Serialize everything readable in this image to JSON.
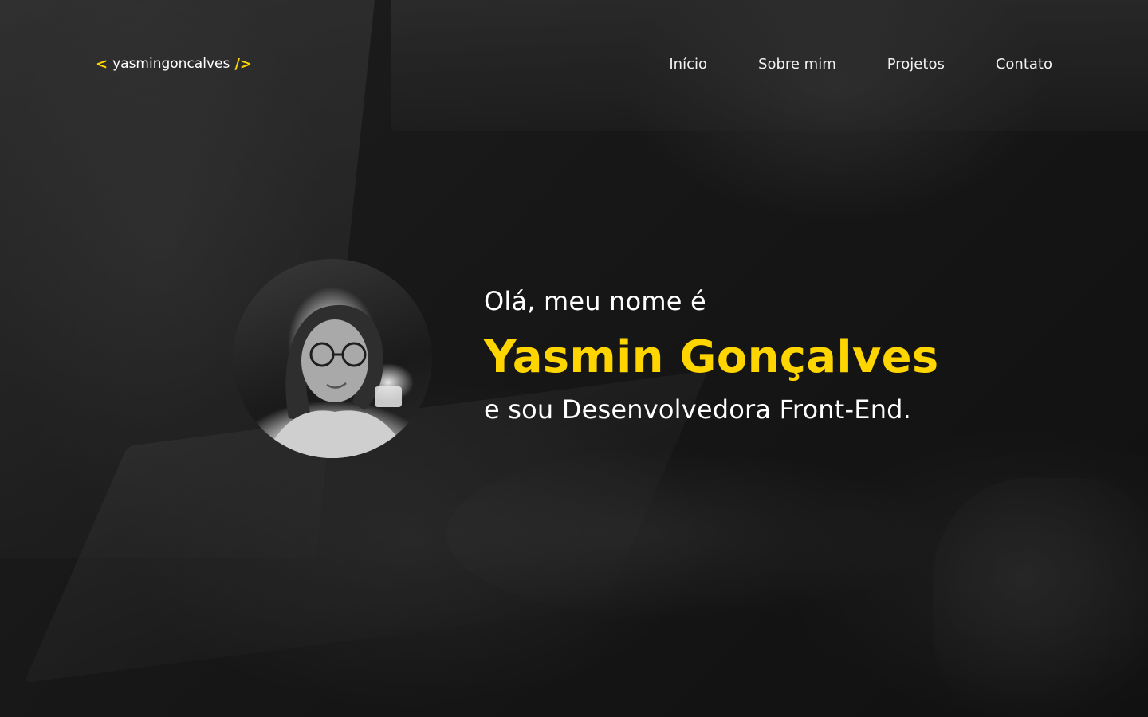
{
  "brand": {
    "open_bracket": "<",
    "name": "yasmingoncalves",
    "close_bracket": "/>",
    "accent_color": "#ffd500"
  },
  "nav": {
    "items": [
      {
        "label": "Início"
      },
      {
        "label": "Sobre mim"
      },
      {
        "label": "Projetos"
      },
      {
        "label": "Contato"
      }
    ]
  },
  "hero": {
    "greeting": "Olá, meu nome é",
    "name": "Yasmin Gonçalves",
    "role": "e sou Desenvolvedora Front-End.",
    "avatar_alt": "Yasmin Gonçalves"
  },
  "icons": {
    "avatar": "profile-photo"
  }
}
